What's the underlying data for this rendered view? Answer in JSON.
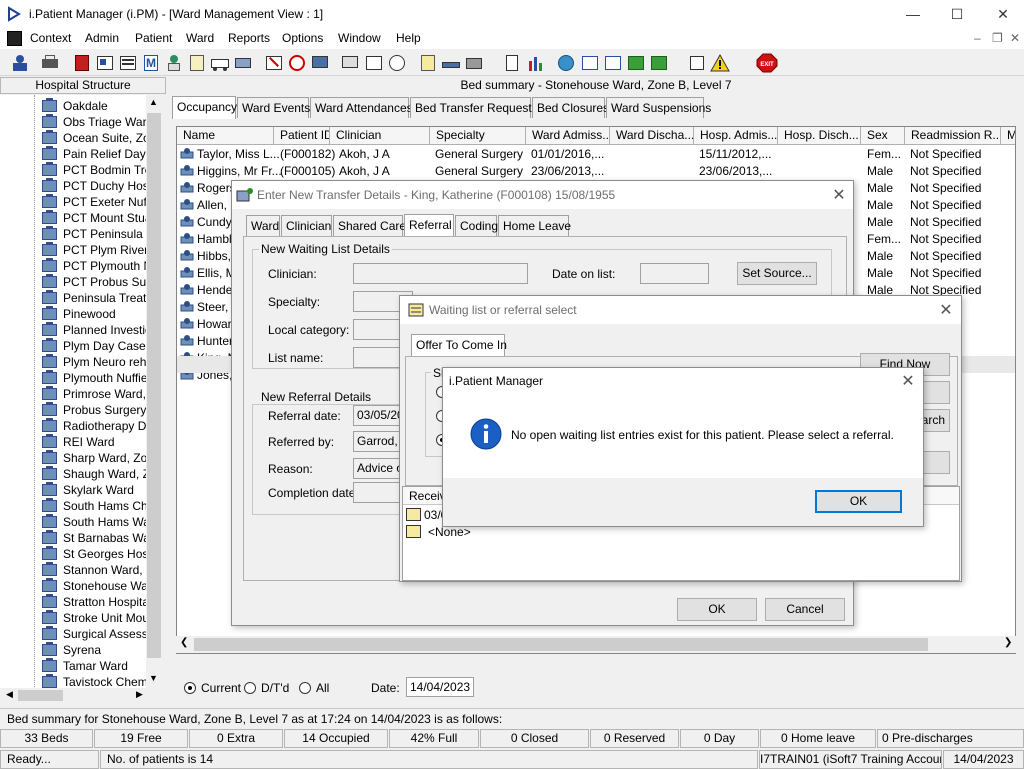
{
  "window": {
    "title": "i.Patient Manager (i.PM) - [Ward Management View : 1]",
    "minimize": "—",
    "maximize": "☐",
    "close": "✕"
  },
  "menu": [
    "Context",
    "Admin",
    "Patient",
    "Ward",
    "Reports",
    "Options",
    "Window",
    "Help"
  ],
  "mdi_controls": [
    "–",
    "❐",
    "✕"
  ],
  "left_panel": {
    "header": "Hospital Structure",
    "items": [
      "Oakdale",
      "Obs Triage Ward",
      "Ocean Suite, Zor",
      "Pain Relief Day C",
      "PCT Bodmin Trea",
      "PCT Duchy Hosp",
      "PCT Exeter Nuffie",
      "PCT Mount Stuar",
      "PCT Peninsula Tr",
      "PCT Plym River F",
      "PCT Plymouth Nu",
      "PCT Probus Surg",
      "Peninsula Treatm",
      "Pinewood",
      "Planned Investig",
      "Plym Day Case U",
      "Plym Neuro rehab",
      "Plymouth Nuffield",
      "Primrose Ward, Z",
      "Probus Surgery V",
      "Radiotherapy Day",
      "REI Ward",
      "Sharp Ward, Zon",
      "Shaugh Ward, Zo",
      "Skylark Ward",
      "South Hams Cher",
      "South Hams War",
      "St Barnabas War",
      "St Georges Hosp",
      "Stannon Ward, Z",
      "Stonehouse Ward",
      "Stratton Hospital",
      "Stroke Unit Mour",
      "Surgical Assessm",
      "Syrena",
      "Tamar Ward",
      "Tavistock Chemo"
    ]
  },
  "bed_summary_title": "Bed summary - Stonehouse Ward, Zone B, Level 7",
  "tabs": [
    "Occupancy",
    "Ward Events",
    "Ward Attendances",
    "Bed Transfer Requests",
    "Bed Closures",
    "Ward Suspensions"
  ],
  "grid": {
    "columns": [
      "Name",
      "Patient ID",
      "Clinician",
      "Specialty",
      "Ward Admiss...",
      "Ward Discha...",
      "Hosp. Admis...",
      "Hosp. Disch...",
      "Sex",
      "Readmission R...",
      "M"
    ],
    "rows": [
      {
        "name": "Taylor, Miss L...",
        "id": "(F000182)",
        "clinician": "Akoh, J A",
        "specialty": "General Surgery",
        "ward_adm": "01/01/2016,...",
        "hosp_adm": "15/11/2012,...",
        "sex": "Fem...",
        "readm": "Not Specified"
      },
      {
        "name": "Higgins, Mr Fr...",
        "id": "(F000105)",
        "clinician": "Akoh, J A",
        "specialty": "General Surgery",
        "ward_adm": "23/06/2013,...",
        "hosp_adm": "23/06/2013,...",
        "sex": "Male",
        "readm": "Not Specified"
      },
      {
        "name": "Rogers",
        "id": "",
        "clinician": "",
        "specialty": "",
        "ward_adm": "",
        "hosp_adm": "",
        "sex": "Male",
        "readm": "Not Specified"
      },
      {
        "name": "Allen, M",
        "id": "",
        "clinician": "",
        "specialty": "",
        "ward_adm": "",
        "hosp_adm": "",
        "sex": "Male",
        "readm": "Not Specified"
      },
      {
        "name": "Cundy,",
        "id": "",
        "clinician": "",
        "specialty": "",
        "ward_adm": "",
        "hosp_adm": "",
        "sex": "Male",
        "readm": "Not Specified"
      },
      {
        "name": "Hamble",
        "id": "",
        "clinician": "",
        "specialty": "",
        "ward_adm": "",
        "hosp_adm": "",
        "sex": "Fem...",
        "readm": "Not Specified"
      },
      {
        "name": "Hibbs, I",
        "id": "",
        "clinician": "",
        "specialty": "",
        "ward_adm": "",
        "hosp_adm": "",
        "sex": "Male",
        "readm": "Not Specified"
      },
      {
        "name": "Ellis, M",
        "id": "",
        "clinician": "",
        "specialty": "",
        "ward_adm": "",
        "hosp_adm": "",
        "sex": "Male",
        "readm": "Not Specified"
      },
      {
        "name": "Hender",
        "id": "",
        "clinician": "",
        "specialty": "",
        "ward_adm": "",
        "hosp_adm": "",
        "sex": "Male",
        "readm": "Not Specified"
      },
      {
        "name": "Steer, M",
        "id": "",
        "clinician": "",
        "specialty": "",
        "ward_adm": "",
        "hosp_adm": "",
        "sex": "",
        "readm": "ied"
      },
      {
        "name": "Howard",
        "id": "",
        "clinician": "",
        "specialty": "",
        "ward_adm": "",
        "hosp_adm": "",
        "sex": "",
        "readm": "ied"
      },
      {
        "name": "Hunter,",
        "id": "",
        "clinician": "",
        "specialty": "",
        "ward_adm": "",
        "hosp_adm": "",
        "sex": "",
        "readm": "ied"
      },
      {
        "name": "King, M",
        "id": "",
        "clinician": "",
        "specialty": "",
        "ward_adm": "",
        "hosp_adm": "",
        "sex": "",
        "readm": "ied"
      },
      {
        "name": "Jones,",
        "id": "",
        "clinician": "",
        "specialty": "",
        "ward_adm": "",
        "hosp_adm": "",
        "sex": "",
        "readm": "ied"
      }
    ]
  },
  "filter": {
    "current": "Current",
    "dtd": "D/T'd",
    "all": "All",
    "date_label": "Date:",
    "date_value": "14/04/2023"
  },
  "transfer_dialog": {
    "title": "Enter New Transfer Details - King, Katherine (F000108) 15/08/1955",
    "tabs": [
      "Ward",
      "Clinician",
      "Shared Care",
      "Referral",
      "Coding",
      "Home Leave"
    ],
    "waiting_group": "New Waiting List Details",
    "clinician_lbl": "Clinician:",
    "specialty_lbl": "Specialty:",
    "local_cat_lbl": "Local category:",
    "list_name_lbl": "List name:",
    "date_on_list_lbl": "Date on list:",
    "set_source": "Set Source...",
    "referral_group": "New Referral Details",
    "referral_date_lbl": "Referral date:",
    "referral_date_val": "03/05/20",
    "referred_by_lbl": "Referred by:",
    "referred_by_val": "Garrod, D",
    "reason_lbl": "Reason:",
    "reason_val": "Advice or",
    "completion_lbl": "Completion date:",
    "ok": "OK",
    "cancel": "Cancel"
  },
  "select_dialog": {
    "title": "Waiting list or referral select",
    "tab": "Offer To Come In",
    "sh_fragment": "Sh",
    "find_now": "Find Now",
    "btn2": "el",
    "btn3": "arch",
    "received_hdr": "Receive",
    "row1": "03/0",
    "row2": "<None>"
  },
  "message_box": {
    "title": "i.Patient Manager",
    "message": "No open waiting list entries exist for this patient. Please select a referral.",
    "ok": "OK"
  },
  "status": {
    "summary_line": "Bed summary for Stonehouse Ward, Zone B, Level 7 as at 17:24 on 14/04/2023 is as follows:",
    "stats": [
      "33 Beds",
      "19 Free",
      "0 Extra",
      "14 Occupied",
      "42% Full",
      "0 Closed",
      "0 Reserved",
      "0 Day",
      "0 Home leave",
      "0 Pre-discharges"
    ],
    "ready": "Ready...",
    "patients": "No. of patients is 14",
    "account": "I7TRAIN01 (iSoft7 Training Account)",
    "date": "14/04/2023"
  }
}
